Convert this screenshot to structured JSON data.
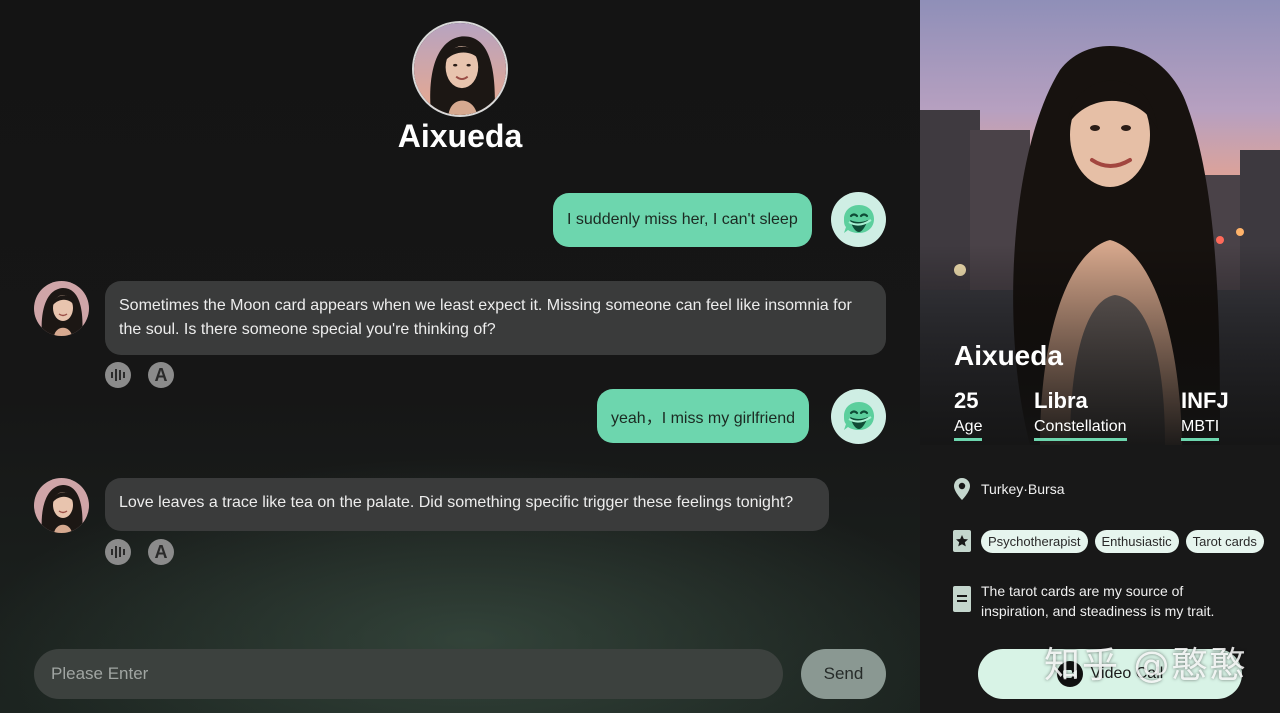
{
  "header": {
    "character_name": "Aixueda"
  },
  "messages": [
    {
      "role": "user",
      "text": "I suddenly miss her, I can't sleep"
    },
    {
      "role": "bot",
      "text": "Sometimes the Moon card appears when we least expect it. Missing someone can feel like insomnia for the soul. Is there someone special you're thinking of?",
      "tools": [
        "voice-icon",
        "translate-icon"
      ]
    },
    {
      "role": "user",
      "text": "yeah，I miss my girlfriend"
    },
    {
      "role": "bot",
      "text": "Love leaves a trace like tea on the palate. Did something specific trigger these feelings tonight?",
      "tools": [
        "voice-icon",
        "translate-icon"
      ]
    }
  ],
  "tool_letter": "A",
  "composer": {
    "placeholder": "Please Enter",
    "send_label": "Send"
  },
  "profile": {
    "name": "Aixueda",
    "stats": [
      {
        "value": "25",
        "label": "Age"
      },
      {
        "value": "Libra",
        "label": "Constellation"
      },
      {
        "value": "INFJ",
        "label": "MBTI"
      }
    ],
    "location": "Turkey·Bursa",
    "tags": [
      "Psychotherapist",
      "Enthusiastic",
      "Tarot cards"
    ],
    "bio": "The tarot cards are my source of inspiration, and steadiness is my trait.",
    "video_call_label": "Video Call"
  },
  "watermark": "知乎 @憨憨",
  "colors": {
    "accent": "#6dd6ae",
    "bot_bubble": "#3a3b3b",
    "user_bubble": "#6dd6ae"
  }
}
